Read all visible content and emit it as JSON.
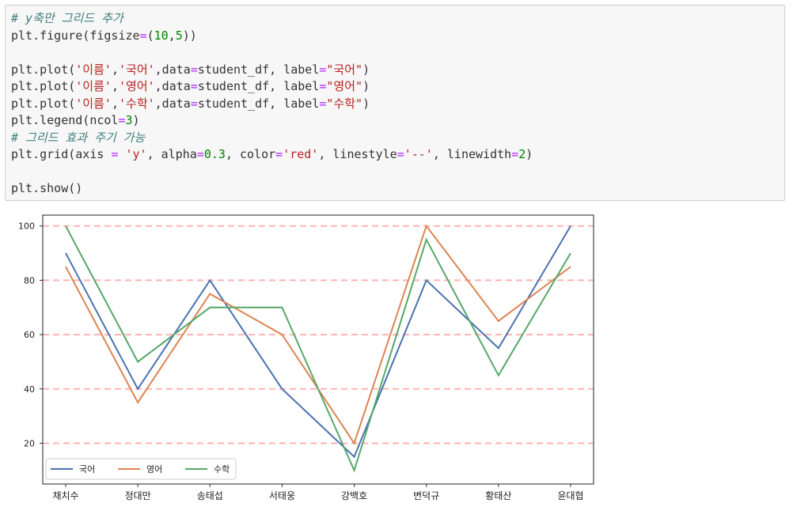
{
  "code_cell": {
    "lines": [
      [
        {
          "t": "# y축만 그리드 추가",
          "c": "comment"
        }
      ],
      [
        {
          "t": "plt.figure(figsize",
          "c": ""
        },
        {
          "t": "=",
          "c": "op"
        },
        {
          "t": "(",
          "c": ""
        },
        {
          "t": "10",
          "c": "num"
        },
        {
          "t": ",",
          "c": ""
        },
        {
          "t": "5",
          "c": "num"
        },
        {
          "t": "))",
          "c": ""
        }
      ],
      [],
      [
        {
          "t": "plt.plot(",
          "c": ""
        },
        {
          "t": "'이름'",
          "c": "str"
        },
        {
          "t": ",",
          "c": ""
        },
        {
          "t": "'국어'",
          "c": "str"
        },
        {
          "t": ",data",
          "c": ""
        },
        {
          "t": "=",
          "c": "op"
        },
        {
          "t": "student_df, label",
          "c": ""
        },
        {
          "t": "=",
          "c": "op"
        },
        {
          "t": "\"국어\"",
          "c": "str"
        },
        {
          "t": ")",
          "c": ""
        }
      ],
      [
        {
          "t": "plt.plot(",
          "c": ""
        },
        {
          "t": "'이름'",
          "c": "str"
        },
        {
          "t": ",",
          "c": ""
        },
        {
          "t": "'영어'",
          "c": "str"
        },
        {
          "t": ",data",
          "c": ""
        },
        {
          "t": "=",
          "c": "op"
        },
        {
          "t": "student_df, label",
          "c": ""
        },
        {
          "t": "=",
          "c": "op"
        },
        {
          "t": "\"영어\"",
          "c": "str"
        },
        {
          "t": ")",
          "c": ""
        }
      ],
      [
        {
          "t": "plt.plot(",
          "c": ""
        },
        {
          "t": "'이름'",
          "c": "str"
        },
        {
          "t": ",",
          "c": ""
        },
        {
          "t": "'수학'",
          "c": "str"
        },
        {
          "t": ",data",
          "c": ""
        },
        {
          "t": "=",
          "c": "op"
        },
        {
          "t": "student_df, label",
          "c": ""
        },
        {
          "t": "=",
          "c": "op"
        },
        {
          "t": "\"수학\"",
          "c": "str"
        },
        {
          "t": ")",
          "c": ""
        }
      ],
      [
        {
          "t": "plt.legend(ncol",
          "c": ""
        },
        {
          "t": "=",
          "c": "op"
        },
        {
          "t": "3",
          "c": "num"
        },
        {
          "t": ")",
          "c": ""
        }
      ],
      [
        {
          "t": "# 그리드 효과 주기 가능",
          "c": "comment"
        }
      ],
      [
        {
          "t": "plt.grid(axis ",
          "c": ""
        },
        {
          "t": "=",
          "c": "op"
        },
        {
          "t": " ",
          "c": ""
        },
        {
          "t": "'y'",
          "c": "str"
        },
        {
          "t": ", alpha",
          "c": ""
        },
        {
          "t": "=",
          "c": "op"
        },
        {
          "t": "0.3",
          "c": "num"
        },
        {
          "t": ", color",
          "c": ""
        },
        {
          "t": "=",
          "c": "op"
        },
        {
          "t": "'red'",
          "c": "str"
        },
        {
          "t": ", linestyle",
          "c": ""
        },
        {
          "t": "=",
          "c": "op"
        },
        {
          "t": "'--'",
          "c": "str"
        },
        {
          "t": ", linewidth",
          "c": ""
        },
        {
          "t": "=",
          "c": "op"
        },
        {
          "t": "2",
          "c": "num"
        },
        {
          "t": ")",
          "c": ""
        }
      ],
      [],
      [
        {
          "t": "plt.show()",
          "c": ""
        }
      ]
    ]
  },
  "chart_data": {
    "type": "line",
    "categories": [
      "채치수",
      "정대만",
      "송태섭",
      "서태웅",
      "강백호",
      "변덕규",
      "황태산",
      "윤대협"
    ],
    "series": [
      {
        "name": "국어",
        "color": "#4c72b0",
        "values": [
          90,
          40,
          80,
          40,
          15,
          80,
          55,
          100
        ]
      },
      {
        "name": "영어",
        "color": "#dd8452",
        "values": [
          85,
          35,
          75,
          60,
          20,
          100,
          65,
          85
        ]
      },
      {
        "name": "수학",
        "color": "#55a868",
        "values": [
          100,
          50,
          70,
          70,
          10,
          95,
          45,
          90
        ]
      }
    ],
    "yticks": [
      "20",
      "40",
      "60",
      "80",
      "100"
    ],
    "ylim": [
      5,
      104
    ],
    "grid": {
      "axis": "y",
      "color": "#ff0000",
      "alpha": 0.3,
      "linestyle": "dashed"
    },
    "legend": {
      "placement": "lower-left",
      "ncol": 3
    },
    "title": "",
    "xlabel": "",
    "ylabel": ""
  }
}
